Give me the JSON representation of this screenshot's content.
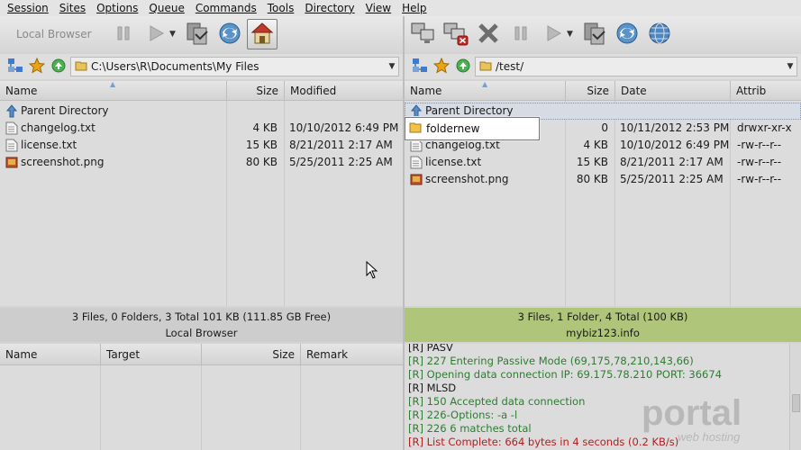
{
  "menu": [
    "Session",
    "Sites",
    "Options",
    "Queue",
    "Commands",
    "Tools",
    "Directory",
    "View",
    "Help"
  ],
  "toolbar_left": {
    "local_browser_label": "Local Browser"
  },
  "local": {
    "path": "C:\\Users\\R\\Documents\\My Files",
    "columns": {
      "name": "Name",
      "size": "Size",
      "modified": "Modified"
    },
    "parent": "Parent Directory",
    "files": [
      {
        "name": "changelog.txt",
        "size": "4 KB",
        "modified": "10/10/2012 6:49 PM",
        "icon": "text-file-icon"
      },
      {
        "name": "license.txt",
        "size": "15 KB",
        "modified": "8/21/2011 2:17 AM",
        "icon": "text-file-icon"
      },
      {
        "name": "screenshot.png",
        "size": "80 KB",
        "modified": "5/25/2011 2:25 AM",
        "icon": "image-file-icon"
      }
    ],
    "status_summary": "3 Files, 0 Folders, 3 Total 101 KB (111.85 GB Free)",
    "status_label": "Local Browser"
  },
  "remote": {
    "path": "/test/",
    "columns": {
      "name": "Name",
      "size": "Size",
      "date": "Date",
      "attrib": "Attrib"
    },
    "parent": "Parent Directory",
    "files": [
      {
        "name": "foldernew",
        "size": "0",
        "date": "10/11/2012 2:53 PM",
        "attrib": "drwxr-xr-x",
        "icon": "folder-icon"
      },
      {
        "name": "changelog.txt",
        "size": "4 KB",
        "date": "10/10/2012 6:49 PM",
        "attrib": "-rw-r--r--",
        "icon": "text-file-icon"
      },
      {
        "name": "license.txt",
        "size": "15 KB",
        "date": "8/21/2011 2:17 AM",
        "attrib": "-rw-r--r--",
        "icon": "text-file-icon"
      },
      {
        "name": "screenshot.png",
        "size": "80 KB",
        "date": "5/25/2011 2:25 AM",
        "attrib": "-rw-r--r--",
        "icon": "image-file-icon"
      }
    ],
    "rename_value": "foldernew",
    "status_summary": "3 Files, 1 Folder, 4 Total (100 KB)",
    "status_label": "mybiz123.info"
  },
  "queue": {
    "columns": {
      "name": "Name",
      "target": "Target",
      "size": "Size",
      "remark": "Remark"
    }
  },
  "log": [
    {
      "text": "[R] PASV",
      "color": "#1a1a1a"
    },
    {
      "text": "[R] 227 Entering Passive Mode (69,175,78,210,143,66)",
      "color": "#2e7d32"
    },
    {
      "text": "[R] Opening data connection IP: 69.175.78.210 PORT: 36674",
      "color": "#2e7d32"
    },
    {
      "text": "[R] MLSD",
      "color": "#1a1a1a"
    },
    {
      "text": "[R] 150 Accepted data connection",
      "color": "#2e7d32"
    },
    {
      "text": "[R] 226-Options: -a -l",
      "color": "#2e7d32"
    },
    {
      "text": "[R] 226 6 matches total",
      "color": "#2e7d32"
    },
    {
      "text": "[R] List Complete: 664 bytes in 4 seconds (0.2 KB/s)",
      "color": "#b71c1c"
    }
  ],
  "watermark": {
    "brand": "portal",
    "sub": "web hosting"
  }
}
